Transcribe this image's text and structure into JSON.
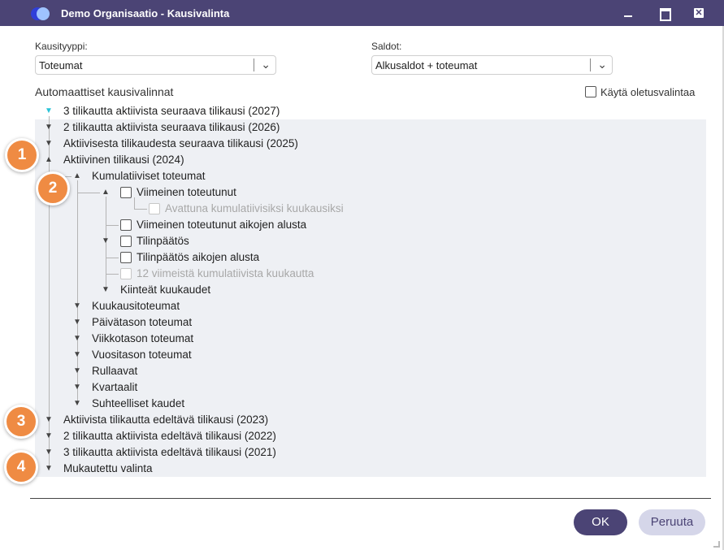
{
  "window": {
    "title": "Demo Organisaatio - Kausivalinta"
  },
  "form": {
    "period_type": {
      "label": "Kausityyppi:",
      "value": "Toteumat"
    },
    "balances": {
      "label": "Saldot:",
      "value": "Alkusaldot + toteumat"
    },
    "section_title": "Automaattiset kausivalinnat",
    "use_default_label": "Käytä oletusvalintaa"
  },
  "tree": {
    "n2027": "3 tilikautta aktiivista seuraava tilikausi (2027)",
    "n2026": "2 tilikautta aktiivista seuraava tilikausi (2026)",
    "n2025": "Aktiivisesta tilikaudesta seuraava tilikausi (2025)",
    "n2024": "Aktiivinen tilikausi (2024)",
    "cumulative": "Kumulatiiviset toteumat",
    "last_realized": "Viimeinen toteutunut",
    "opened_cumulative": "Avattuna kumulatiivisiksi kuukausiksi",
    "last_realized_all": "Viimeinen toteutunut aikojen alusta",
    "closing": "Tilinpäätös",
    "closing_all": "Tilinpäätös aikojen alusta",
    "last12": "12 viimeistä kumulatiivista kuukautta",
    "fixed_months": "Kiinteät kuukaudet",
    "monthly": "Kuukausitoteumat",
    "daily": "Päivätason toteumat",
    "weekly": "Viikkotason toteumat",
    "yearly": "Vuositason toteumat",
    "rolling": "Rullaavat",
    "quarters": "Kvartaalit",
    "relative": "Suhteelliset kaudet",
    "n2023": "Aktiivista tilikautta edeltävä tilikausi (2023)",
    "n2022": "2 tilikautta aktiivista edeltävä tilikausi (2022)",
    "n2021": "3 tilikautta aktiivista edeltävä tilikausi (2021)",
    "custom": "Mukautettu valinta"
  },
  "badges": {
    "b1": "1",
    "b2": "2",
    "b3": "3",
    "b4": "4"
  },
  "buttons": {
    "ok": "OK",
    "cancel": "Peruuta"
  },
  "icons": {
    "collapse": "▼",
    "expand": "▲",
    "chevron": "⌄",
    "close": "✕"
  },
  "colors": {
    "titlebar": "#4b4475",
    "badge": "#ef8b43",
    "tree_bg": "#eef0f4",
    "ok_button": "#4b4475",
    "cancel_button": "#d5d6e9"
  }
}
